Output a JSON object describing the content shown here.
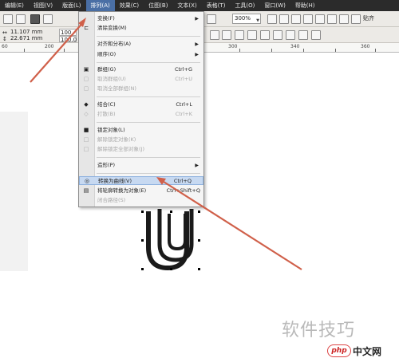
{
  "menubar": {
    "items": [
      "编辑(E)",
      "视图(V)",
      "版面(L)",
      "排列(A)",
      "效果(C)",
      "位图(B)",
      "文本(X)",
      "表格(T)",
      "工具(O)",
      "窗口(W)",
      "帮助(H)"
    ],
    "active_index": 3
  },
  "toolbar": {
    "zoom": "300%",
    "snap_label": "贴齐"
  },
  "property_bar": {
    "width_value": "11.107 mm",
    "height_value": "22.671 mm",
    "field_a": "100",
    "field_b": "100.0"
  },
  "ruler": {
    "ticks": [
      "60",
      "200",
      "300",
      "340",
      "360"
    ]
  },
  "arrange_menu": {
    "items": [
      {
        "label": "变换(F)",
        "shortcut": "",
        "submenu": true,
        "disabled": false,
        "icon": ""
      },
      {
        "label": "清除变换(M)",
        "shortcut": "",
        "submenu": false,
        "disabled": false,
        "icon": "clear-transform-icon"
      },
      {
        "label": "对齐和分布(A)",
        "shortcut": "",
        "submenu": true,
        "disabled": false,
        "icon": ""
      },
      {
        "label": "顺序(O)",
        "shortcut": "",
        "submenu": true,
        "disabled": false,
        "icon": ""
      },
      {
        "label": "群组(G)",
        "shortcut": "Ctrl+G",
        "submenu": false,
        "disabled": false,
        "icon": "group-icon"
      },
      {
        "label": "取消群组(U)",
        "shortcut": "Ctrl+U",
        "submenu": false,
        "disabled": true,
        "icon": "ungroup-icon"
      },
      {
        "label": "取消全部群组(N)",
        "shortcut": "",
        "submenu": false,
        "disabled": true,
        "icon": "ungroup-all-icon"
      },
      {
        "label": "结合(C)",
        "shortcut": "Ctrl+L",
        "submenu": false,
        "disabled": false,
        "icon": "combine-icon"
      },
      {
        "label": "打散(B)",
        "shortcut": "Ctrl+K",
        "submenu": false,
        "disabled": true,
        "icon": "break-apart-icon"
      },
      {
        "label": "锁定对象(L)",
        "shortcut": "",
        "submenu": false,
        "disabled": false,
        "icon": "lock-icon"
      },
      {
        "label": "解除锁定对象(K)",
        "shortcut": "",
        "submenu": false,
        "disabled": true,
        "icon": "unlock-icon"
      },
      {
        "label": "解除锁定全部对象(J)",
        "shortcut": "",
        "submenu": false,
        "disabled": true,
        "icon": "unlock-all-icon"
      },
      {
        "label": "造形(P)",
        "shortcut": "",
        "submenu": true,
        "disabled": false,
        "icon": ""
      },
      {
        "label": "转换为曲线(V)",
        "shortcut": "Ctrl+Q",
        "submenu": false,
        "disabled": false,
        "icon": "convert-to-curves-icon",
        "highlighted": true
      },
      {
        "label": "将轮廓转换为对象(E)",
        "shortcut": "Ctrl+Shift+Q",
        "submenu": false,
        "disabled": false,
        "icon": "outline-to-object-icon"
      },
      {
        "label": "闭合路径(S)",
        "shortcut": "",
        "submenu": false,
        "disabled": true,
        "icon": ""
      }
    ]
  },
  "watermark": {
    "text": "软件技巧",
    "site_logo": "php",
    "site_text": "中文网"
  },
  "colors": {
    "menubar_bg": "#2b2b2b",
    "menu_highlight": "#c7d9f1",
    "arrow": "#d0604a",
    "canvas_shape": "#1a1a1a"
  }
}
